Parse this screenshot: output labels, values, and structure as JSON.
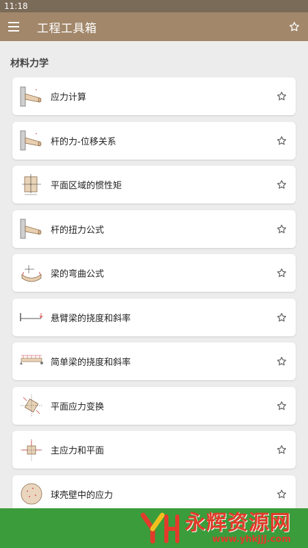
{
  "status_bar": {
    "time": "11:18"
  },
  "app_bar": {
    "title": "工程工具箱",
    "menu_icon": "hamburger-menu-icon",
    "favorite_icon": "star-outline-icon"
  },
  "section": {
    "title": "材料力学"
  },
  "items": [
    {
      "label": "应力计算",
      "icon": "cantilever-rod-icon"
    },
    {
      "label": "杆的力-位移关系",
      "icon": "cantilever-rod-icon"
    },
    {
      "label": "平面区域的惯性矩",
      "icon": "rectangle-section-icon"
    },
    {
      "label": "杆的扭力公式",
      "icon": "cantilever-rod-icon"
    },
    {
      "label": "梁的弯曲公式",
      "icon": "bent-beam-icon"
    },
    {
      "label": "悬臂梁的挠度和斜率",
      "icon": "cantilever-beam-icon"
    },
    {
      "label": "简单梁的挠度和斜率",
      "icon": "simple-beam-icon"
    },
    {
      "label": "平面应力变换",
      "icon": "stress-transformation-icon"
    },
    {
      "label": "主应力和平面",
      "icon": "principal-stress-icon"
    },
    {
      "label": "球壳壁中的应力",
      "icon": "spherical-shell-icon"
    }
  ],
  "banner": {
    "title": "永辉资源网",
    "url": "www.yhkjjj.com",
    "logo": "yh-logo-icon",
    "background": "#3b9c3b",
    "text_color": "#e23b2b"
  },
  "colors": {
    "app_bar": "#a2876a",
    "status_bar": "#7a6a58",
    "background": "#ececec"
  }
}
